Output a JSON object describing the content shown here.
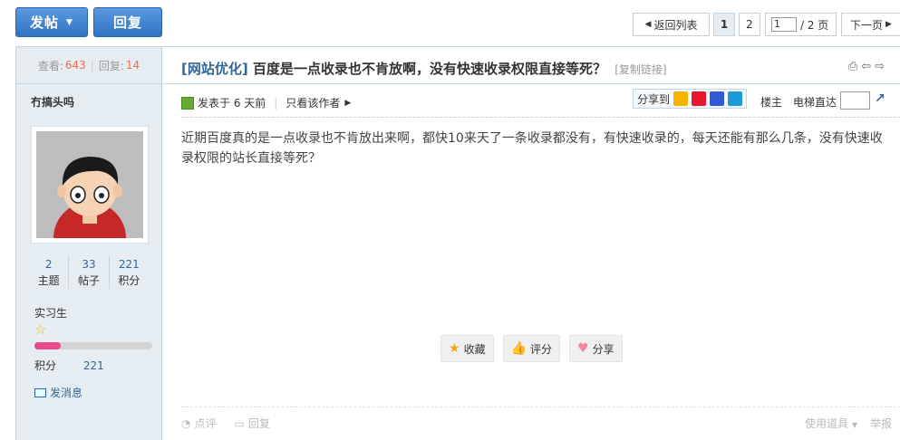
{
  "toolbar": {
    "post_label": "发帖",
    "reply_label": "回复"
  },
  "pagination": {
    "back_label": "返回列表",
    "pages": [
      "1",
      "2"
    ],
    "current_input": "1",
    "total_label": "/ 2 页",
    "next_label": "下一页"
  },
  "thread_stats": {
    "views_label": "查看:",
    "views": "643",
    "replies_label": "回复:",
    "replies": "14"
  },
  "author": {
    "name": "冇搞头吗",
    "topics": "2",
    "topics_label": "主题",
    "posts": "33",
    "posts_label": "帖子",
    "credits": "221",
    "credits_label": "积分",
    "rank": "实习生",
    "points_label": "积分",
    "points": "221",
    "message_label": "发消息"
  },
  "post": {
    "category": "[网站优化]",
    "title": "百度是一点收录也不肯放啊，没有快速收录权限直接等死？",
    "copy_link": "[复制链接]",
    "posted_label": "发表于 6 天前",
    "only_author": "只看该作者",
    "share_label": "分享到",
    "floor_label": "楼主",
    "jump_label": "电梯直达",
    "body": "近期百度真的是一点收录也不肯放出来啊，都快10来天了一条收录都没有，有快速收录的，每天还能有那么几条，没有快速收录权限的站长直接等死？",
    "actions": {
      "favorite": "收藏",
      "rate": "评分",
      "share": "分享"
    },
    "footer": {
      "comment": "点评",
      "reply": "回复",
      "tools": "使用道具",
      "report": "举报"
    }
  },
  "colors": {
    "accent": "#2f73c4",
    "link": "#336699",
    "stat_number": "#f26c4f",
    "sidebar_bg": "#e5edf2"
  }
}
